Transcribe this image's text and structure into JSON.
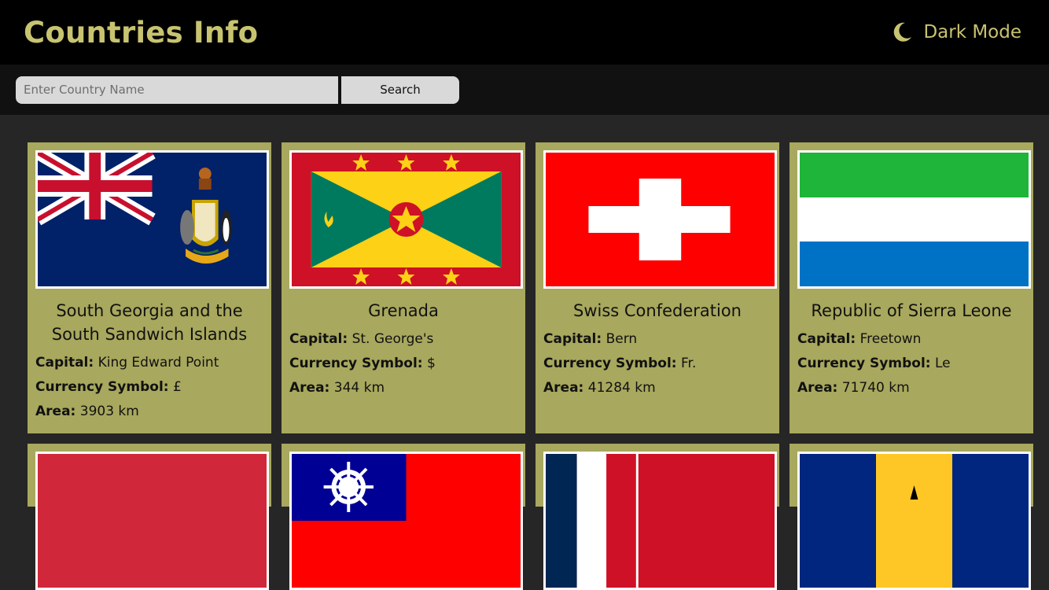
{
  "header": {
    "title": "Countries Info",
    "mode_label": "Dark Mode"
  },
  "search": {
    "placeholder": "Enter Country Name",
    "button_label": "Search"
  },
  "labels": {
    "capital": "Capital:",
    "currency": "Currency Symbol:",
    "area": "Area:"
  },
  "countries": [
    {
      "name": "South Georgia and the South Sandwich Islands",
      "capital": "King Edward Point",
      "currency": "£",
      "area": "3903 km",
      "flag": "south-georgia-flag"
    },
    {
      "name": "Grenada",
      "capital": "St. George's",
      "currency": "$",
      "area": "344 km",
      "flag": "grenada-flag"
    },
    {
      "name": "Swiss Confederation",
      "capital": "Bern",
      "currency": "Fr.",
      "area": "41284 km",
      "flag": "switzerland-flag"
    },
    {
      "name": "Republic of Sierra Leone",
      "capital": "Freetown",
      "currency": "Le",
      "area": "71740 km",
      "flag": "sierra-leone-flag"
    }
  ],
  "partial_flags": [
    "red-flag",
    "taiwan-flag",
    "french-flag",
    "barbados-flag"
  ],
  "colors": {
    "header_bg": "#000000",
    "accent": "#c8c370",
    "card_bg": "#a8a85e",
    "page_bg": "#262626"
  }
}
